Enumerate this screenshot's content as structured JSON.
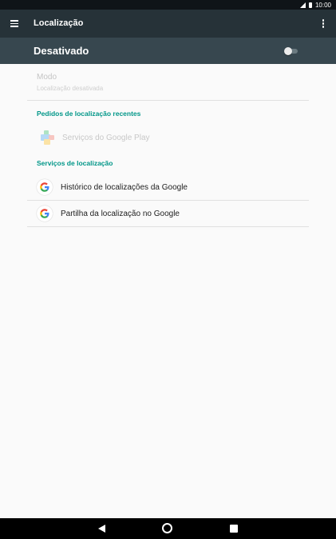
{
  "status_bar": {
    "time": "10:00",
    "icons": [
      "signal-icon",
      "battery-icon"
    ]
  },
  "app_bar": {
    "title": "Localização",
    "menu_icon": "hamburger-menu-icon",
    "overflow_icon": "more-vert-icon"
  },
  "master_switch": {
    "label": "Desativado",
    "enabled": false
  },
  "mode": {
    "title": "Modo",
    "subtitle": "Localização desativada"
  },
  "recent_requests": {
    "header": "Pedidos de localização recentes",
    "items": [
      {
        "label": "Serviços do Google Play",
        "icon": "google-play-services-icon"
      }
    ]
  },
  "location_services": {
    "header": "Serviços de localização",
    "items": [
      {
        "label": "Histórico de localizações da Google",
        "icon": "google-g-icon"
      },
      {
        "label": "Partilha da localização no Google",
        "icon": "google-g-icon"
      }
    ]
  },
  "nav_bar": {
    "buttons": [
      "back-icon",
      "home-icon",
      "recents-icon"
    ]
  },
  "colors": {
    "accent": "#009688",
    "app_bar": "#263238",
    "master_bar": "#37474f",
    "background": "#fafafa"
  }
}
